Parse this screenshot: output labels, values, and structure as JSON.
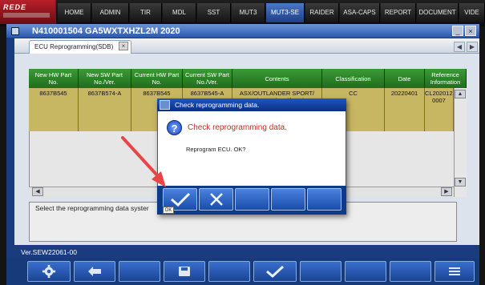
{
  "app": {
    "logo_text": "REDE",
    "nav_tabs": [
      "HOME",
      "ADMIN",
      "TIR",
      "MDL",
      "SST",
      "MUT3",
      "MUT3-SE",
      "RAIDER",
      "ASA-CAPS",
      "REPORT",
      "DOCUMENT",
      "VIDE"
    ],
    "active_tab": "MUT3-SE"
  },
  "window": {
    "title": "N410001504  GA5WXTXHZL2M 2020",
    "tab_label": "ECU Reprogramming(SDB)",
    "tab_close": "×",
    "minimize": "_",
    "close": "×"
  },
  "table": {
    "headers": [
      "New HW Part No.",
      "New SW Part No./Ver.",
      "Current HW Part No.",
      "Current SW Part No./Ver.",
      "Contents",
      "Classification",
      "Date",
      "Reference Information"
    ],
    "row": [
      "8637B545",
      "8637B574-A",
      "8637B545",
      "8637B545-A",
      "ASX/OUTLANDER SPORT/ RVR(GA0W)    Malfunction",
      "CC",
      "20220401",
      "CL20201220 0007"
    ]
  },
  "message": {
    "text": "Select the reprogramming data syster"
  },
  "version": "Ver.SEW22061-00",
  "dialog": {
    "title": "Check reprogramming data.",
    "heading": "Check reprogramming data.",
    "body": "Reprogram ECU. OK?",
    "ok_tooltip": "OK"
  },
  "colors": {
    "nav_active": "#1d3f86",
    "table_header": "#2a7f27",
    "table_row": "#c8b762",
    "dialog_heading": "#c0302a",
    "button_blue": "#1b4cac",
    "annotation_arrow": "#e84646"
  }
}
